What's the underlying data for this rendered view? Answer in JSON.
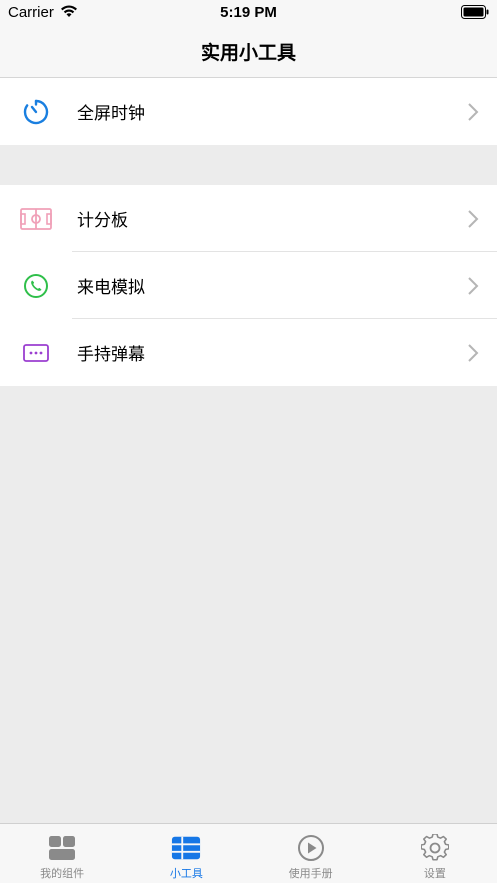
{
  "status_bar": {
    "carrier": "Carrier",
    "time": "5:19 PM"
  },
  "nav": {
    "title": "实用小工具"
  },
  "sections": [
    {
      "items": [
        {
          "label": "全屏时钟",
          "icon": "timer-icon",
          "color": "#1a7fe0"
        }
      ]
    },
    {
      "items": [
        {
          "label": "计分板",
          "icon": "scoreboard-icon",
          "color": "#f0a0b8"
        },
        {
          "label": "来电模拟",
          "icon": "phone-icon",
          "color": "#2fbf4a"
        },
        {
          "label": "手持弹幕",
          "icon": "message-icon",
          "color": "#9b3fd0"
        }
      ]
    }
  ],
  "tabs": [
    {
      "label": "我的组件",
      "icon": "widgets-icon",
      "active": false
    },
    {
      "label": "小工具",
      "icon": "tools-icon",
      "active": true
    },
    {
      "label": "使用手册",
      "icon": "play-icon",
      "active": false
    },
    {
      "label": "设置",
      "icon": "gear-icon",
      "active": false
    }
  ],
  "colors": {
    "accent": "#1677e6",
    "background": "#ececec",
    "inactive": "#8a8a8a"
  }
}
